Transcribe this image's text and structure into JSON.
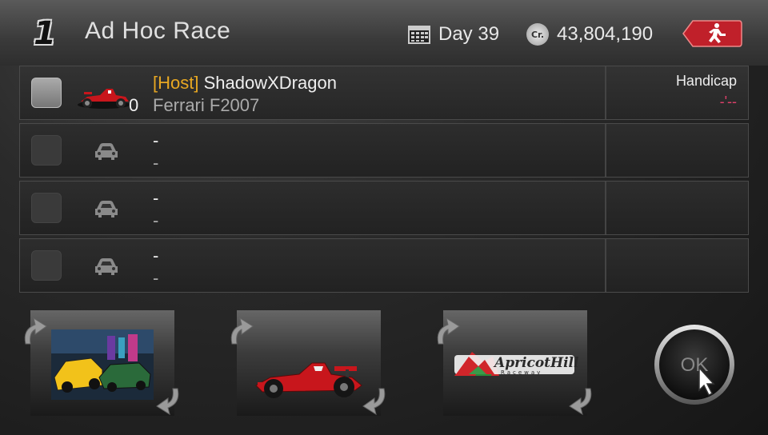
{
  "header": {
    "logo_number": "1",
    "title": "Ad Hoc Race",
    "day": "Day 39",
    "credits": "43,804,190",
    "credits_icon_text": "Cr."
  },
  "rows": [
    {
      "host_tag": "[Host]",
      "player": "ShadowXDragon",
      "car": "Ferrari F2007",
      "car_number": "0",
      "handicap_label": "Handicap",
      "handicap_value": "-'--"
    },
    {
      "player": "-",
      "car": "-"
    },
    {
      "player": "-",
      "car": "-"
    },
    {
      "player": "-",
      "car": "-"
    }
  ],
  "track_logo": {
    "name": "ApricotHill",
    "sub": "Raceway"
  },
  "ok_label": "OK",
  "colors": {
    "host_tag": "#e8a822",
    "handicap_value": "#e0406a",
    "exit_button": "#c0202a"
  }
}
